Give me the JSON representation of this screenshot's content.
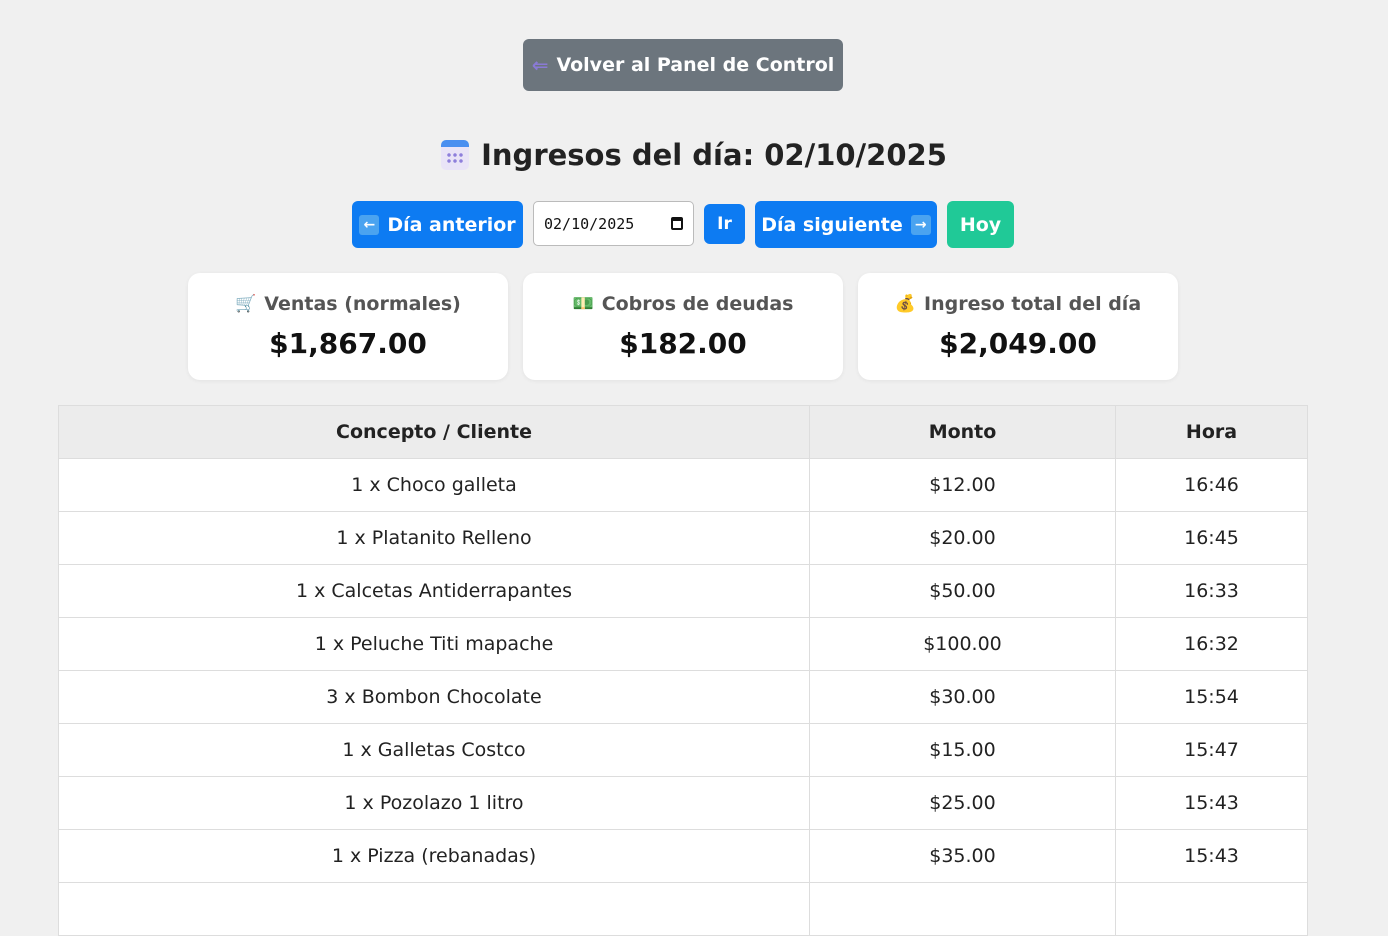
{
  "back_button": {
    "label": "Volver al Panel de Control",
    "icon": "back-arrow-icon"
  },
  "title": {
    "text": "Ingresos del día: 02/10/2025",
    "icon": "calendar-icon"
  },
  "nav": {
    "prev_label": "Día anterior",
    "date_value": "02/10/2025",
    "go_label": "Ir",
    "next_label": "Día siguiente",
    "today_label": "Hoy"
  },
  "cards": [
    {
      "label": "Ventas (normales)",
      "value": "$1,867.00",
      "icon": "cart-icon"
    },
    {
      "label": "Cobros de deudas",
      "value": "$182.00",
      "icon": "money-icon"
    },
    {
      "label": "Ingreso total del día",
      "value": "$2,049.00",
      "icon": "money-bag-icon"
    }
  ],
  "table": {
    "headers": [
      "Concepto / Cliente",
      "Monto",
      "Hora"
    ],
    "rows": [
      [
        "1 x Choco galleta",
        "$12.00",
        "16:46"
      ],
      [
        "1 x Platanito Relleno",
        "$20.00",
        "16:45"
      ],
      [
        "1 x Calcetas Antiderrapantes",
        "$50.00",
        "16:33"
      ],
      [
        "1 x Peluche Titi mapache",
        "$100.00",
        "16:32"
      ],
      [
        "3 x Bombon Chocolate",
        "$30.00",
        "15:54"
      ],
      [
        "1 x Galletas Costco",
        "$15.00",
        "15:47"
      ],
      [
        "1 x Pozolazo 1 litro",
        "$25.00",
        "15:43"
      ],
      [
        "1 x Pizza (rebanadas)",
        "$35.00",
        "15:43"
      ],
      [
        "",
        "",
        ""
      ]
    ]
  }
}
